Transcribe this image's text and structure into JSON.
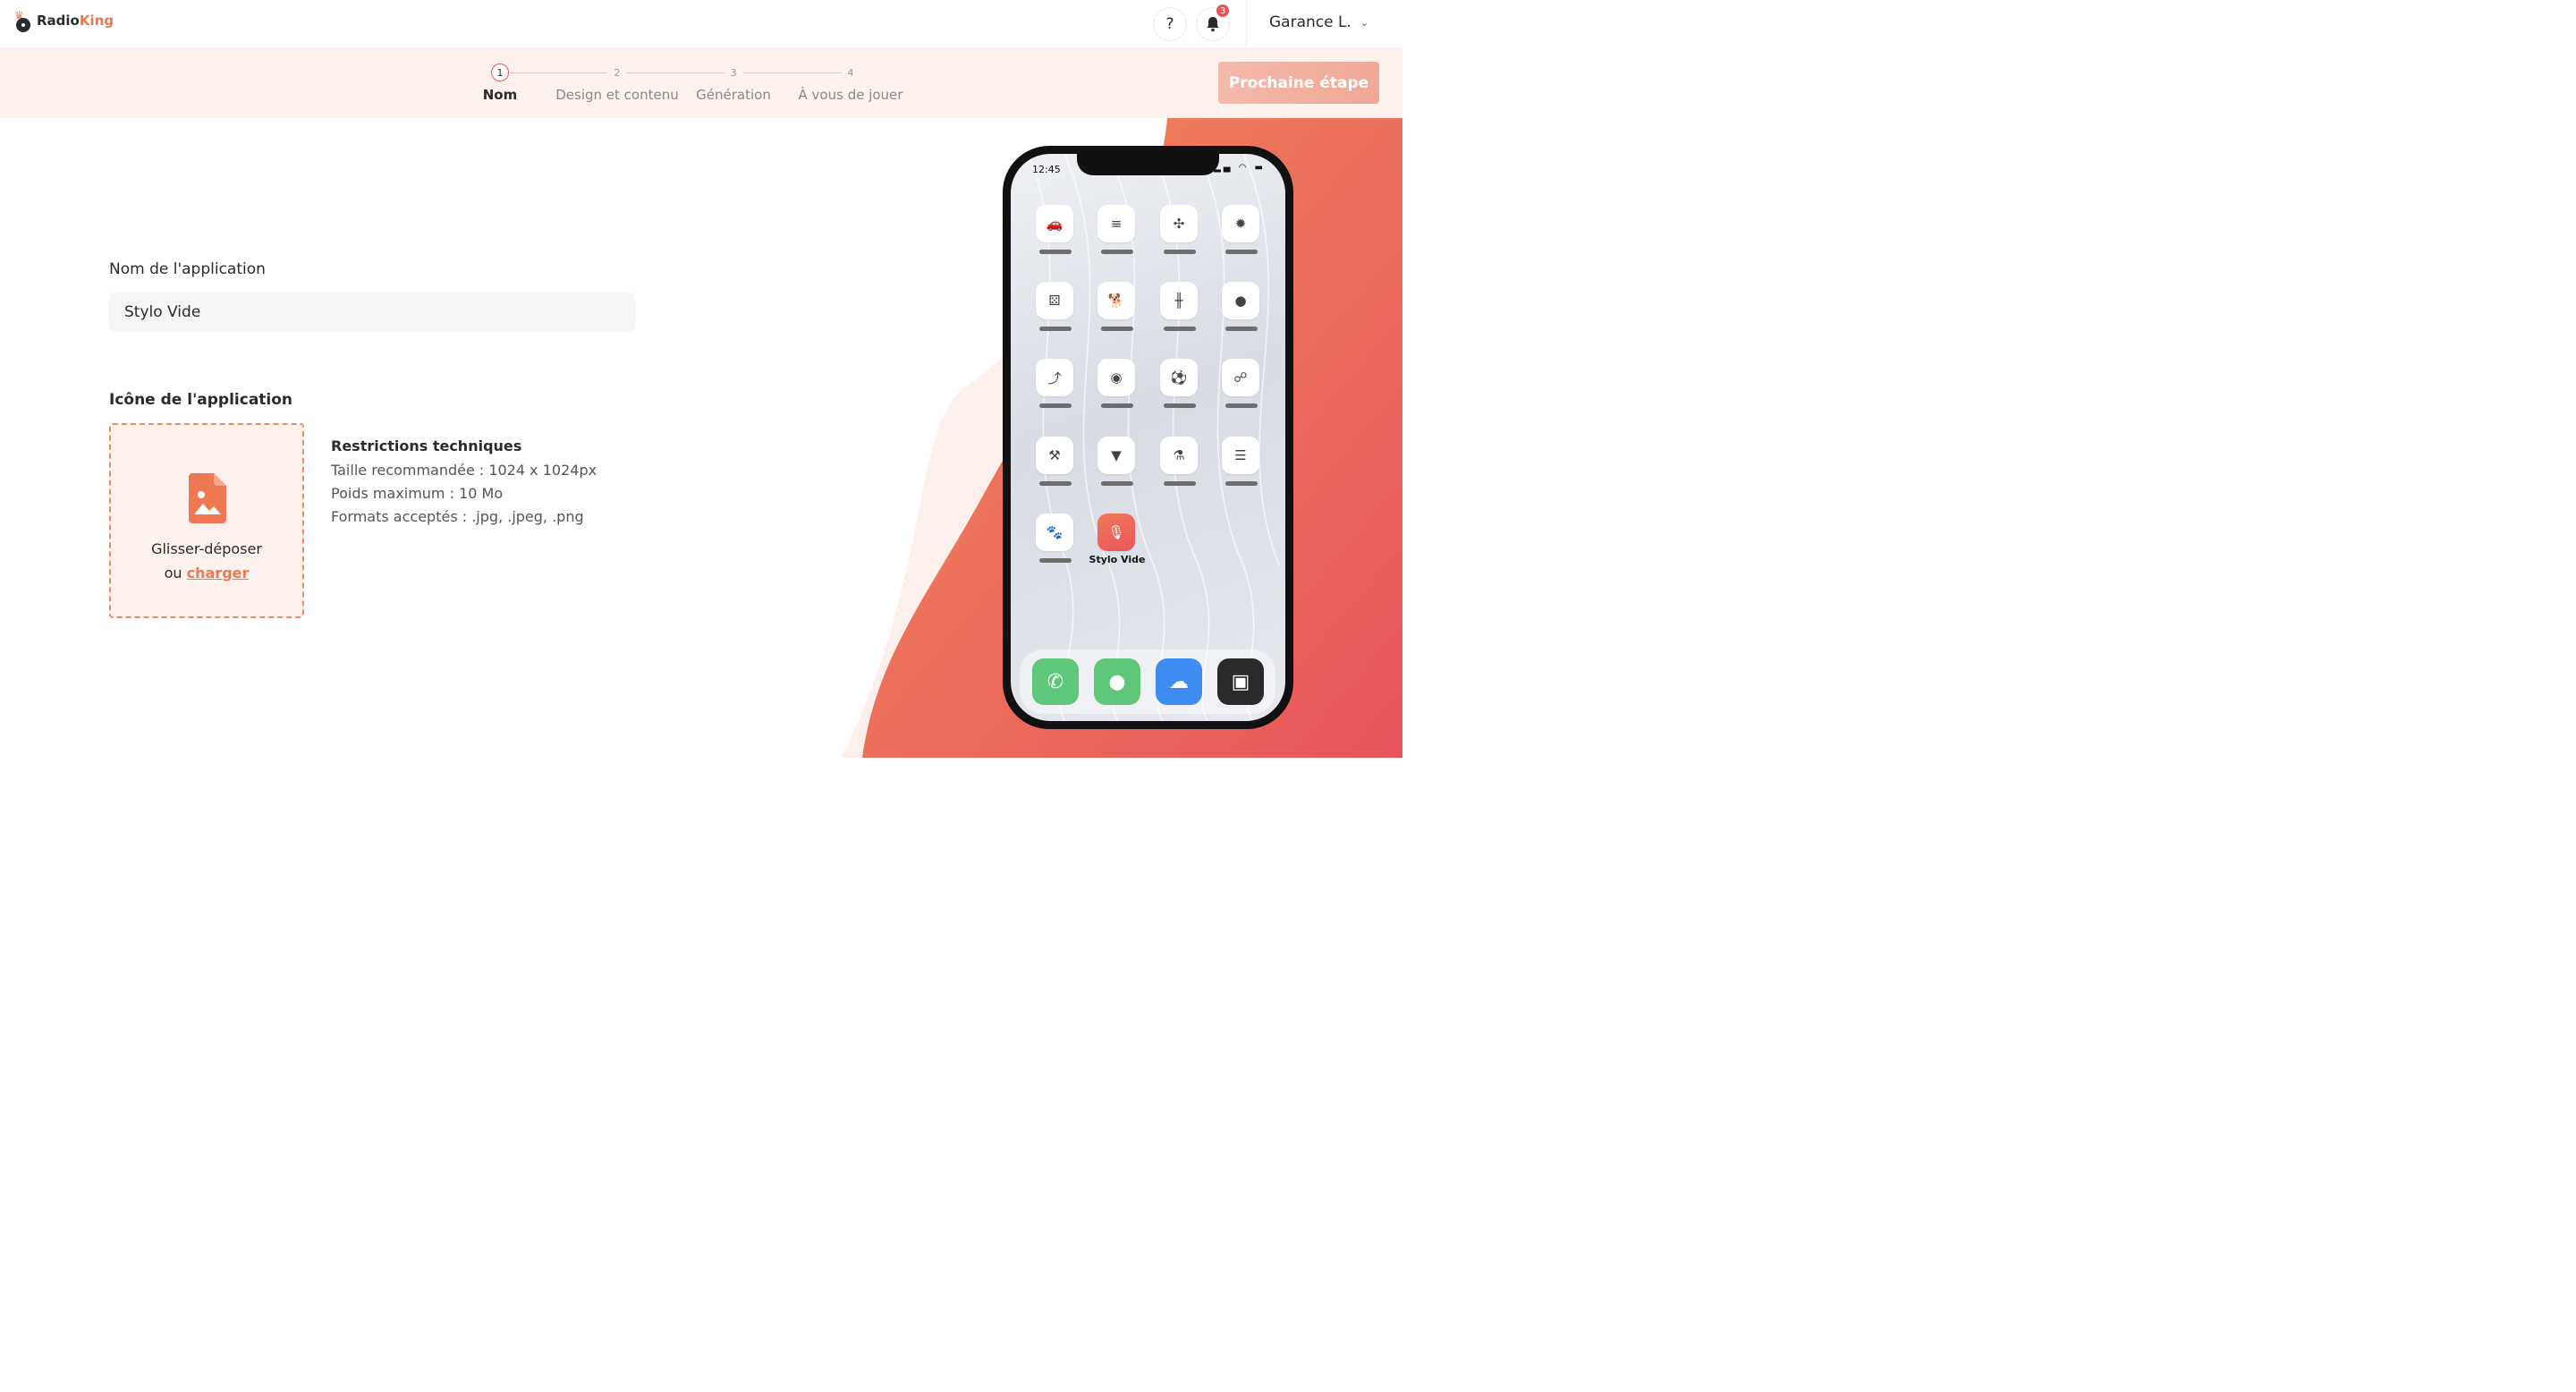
{
  "brand": {
    "name_part1": "Radio",
    "name_part2": "King"
  },
  "header": {
    "help_label": "?",
    "notifications_count": "3",
    "user_name": "Garance L.",
    "user_chevron": "⌄"
  },
  "stepper": {
    "steps": [
      {
        "number": "1",
        "label": "Nom"
      },
      {
        "number": "2",
        "label": "Design et contenu"
      },
      {
        "number": "3",
        "label": "Génération"
      },
      {
        "number": "4",
        "label": "À vous de jouer"
      }
    ],
    "next_label": "Prochaine étape"
  },
  "form": {
    "name_label": "Nom de l'application",
    "name_value": "Stylo Vide",
    "icon_title": "Icône de l'application",
    "dropzone_line1": "Glisser-déposer",
    "dropzone_or": "ou ",
    "dropzone_link": "charger",
    "restrictions": {
      "title": "Restrictions techniques",
      "lines": [
        "Taille recommandée : 1024 x 1024px",
        "Poids maximum : 10 Mo",
        "Formats acceptés : .jpg, .jpeg, .png"
      ]
    }
  },
  "phone": {
    "time": "12:45",
    "status": "▂▄ ◠ ▬",
    "app_icons": [
      "car-icon",
      "database-icon",
      "fan-icon",
      "wheel-icon",
      "dice-icon",
      "dog-icon",
      "dumbbell-icon",
      "egg-icon",
      "boot-icon",
      "vinyl-icon",
      "soccer-ball-icon",
      "binoculars-icon",
      "hammer-icon",
      "ice-cream-icon",
      "microscope-icon",
      "list-icon",
      "paw-icon"
    ],
    "app_glyphs": [
      "🚗",
      "≡",
      "✣",
      "✹",
      "⚄",
      "🐕",
      "╫",
      "●",
      "⤴",
      "◉",
      "⚽",
      "☍",
      "⚒",
      "▼",
      "⚗",
      "☰",
      "🐾"
    ],
    "featured_app_label": "Stylo Vide",
    "featured_app_glyph": "🎙",
    "dock": [
      {
        "name": "phone-app-icon",
        "glyph": "✆",
        "color": "#5fc77a"
      },
      {
        "name": "messages-app-icon",
        "glyph": "●",
        "color": "#5fc77a"
      },
      {
        "name": "weather-app-icon",
        "glyph": "☁",
        "color": "#3f8cf0"
      },
      {
        "name": "photos-app-icon",
        "glyph": "▣",
        "color": "#2a2a2a"
      }
    ]
  },
  "colors": {
    "accent": "#ef7752",
    "danger": "#e8545a",
    "band": "#fdf1ed"
  }
}
